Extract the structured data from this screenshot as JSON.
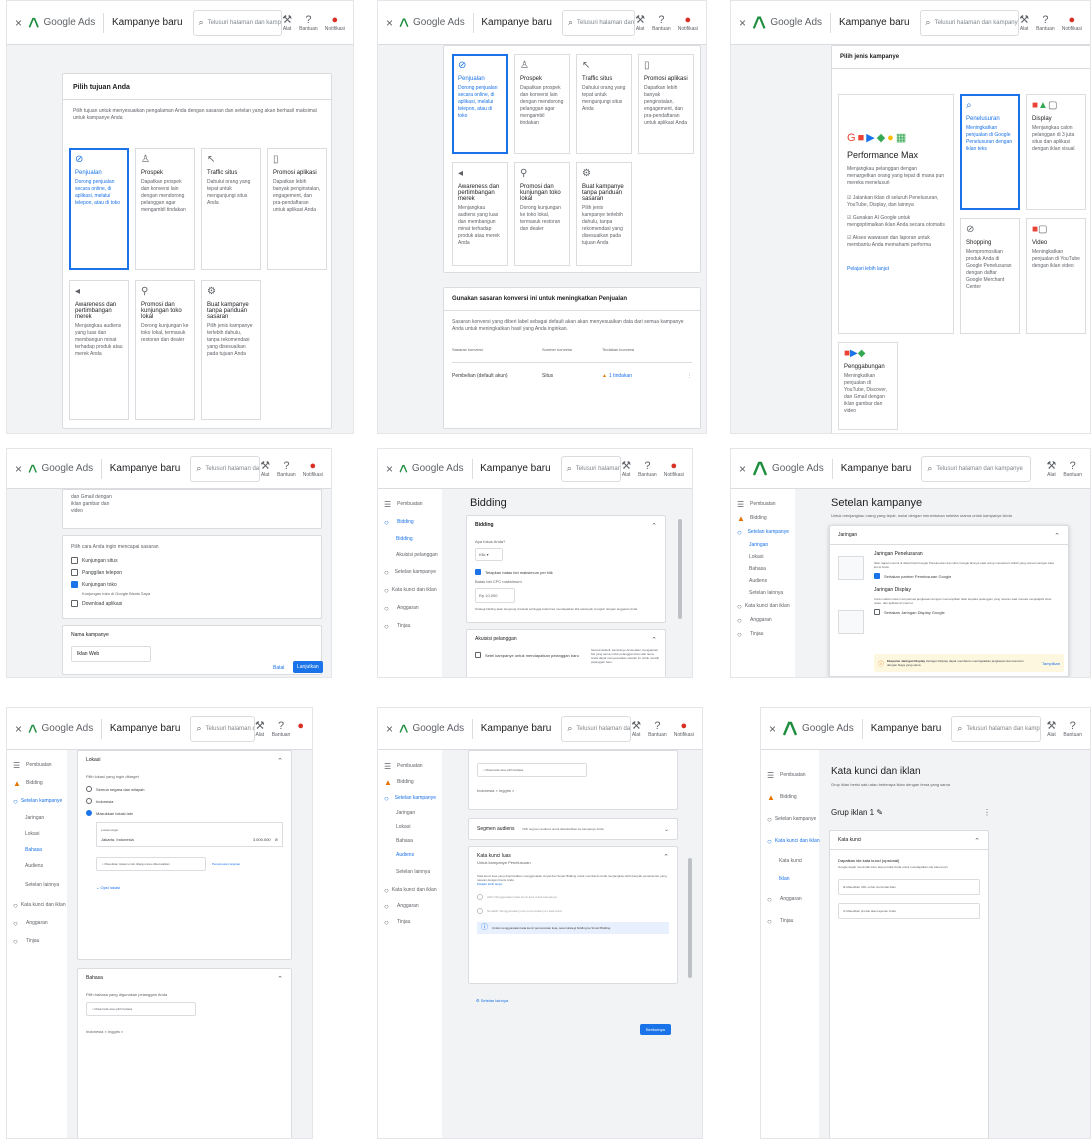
{
  "app": {
    "close_icon": "×",
    "brand": "Google Ads",
    "page_title": "Kampanye baru",
    "search_placeholder": "Telusuri halaman dan kampanye",
    "tools": [
      {
        "icon": "tools-icon",
        "label": "Alat"
      },
      {
        "icon": "help-icon",
        "label": "Bantuan"
      },
      {
        "icon": "notifications-icon",
        "label": "Notifikasi"
      }
    ],
    "accent": "#1a73e8",
    "notification_color": "#d93025"
  },
  "p1": {
    "title": "Pilih tujuan Anda",
    "subtitle": "Pilih tujuan untuk menyesuaikan pengalaman Anda dengan sasaran dan setelan yang akan berhasil maksimal untuk kampanye Anda",
    "goals": [
      {
        "icon": "tag-icon",
        "title": "Penjualan",
        "desc": "Dorong penjualan secara online, di aplikasi, melalui telepon, atau di toko",
        "selected": true
      },
      {
        "icon": "prospects-icon",
        "title": "Prospek",
        "desc": "Dapatkan prospek dan konversi lain dengan mendorong pelanggan agar mengambil tindakan",
        "selected": false
      },
      {
        "icon": "cursor-icon",
        "title": "Traffic situs",
        "desc": "Dahului orang yang tepat untuk mengunjungi situs Anda",
        "selected": false
      },
      {
        "icon": "phone-icon",
        "title": "Promosi aplikasi",
        "desc": "Dapatkan lebih banyak penginstalan, engagement, dan pra-pendaftaran untuk aplikasi Anda",
        "selected": false
      },
      {
        "icon": "megaphone-icon",
        "title": "Awareness dan pertimbangan merek",
        "desc": "Menjangkau audiens yang luas dan membangun minat terhadap produk atau merek Anda",
        "selected": false
      },
      {
        "icon": "location-icon",
        "title": "Promosi dan kunjungan toko lokal",
        "desc": "Dorong kunjungan ke toko lokal, termasuk restoran dan dealer",
        "selected": false
      },
      {
        "icon": "gear-icon",
        "title": "Buat kampanye tanpa panduan sasaran",
        "desc": "Pilih jenis kampanye terlebih dahulu, tanpa rekomendasi yang disesuaikan pada tujuan Anda",
        "selected": false
      }
    ]
  },
  "p2": {
    "conversion_title": "Gunakan sasaran konversi ini untuk meningkatkan Penjualan",
    "conversion_desc": "Sasaran konversi yang diberi label sebagai default akan akan menyesuaikan data dari semua kampanye Anda untuk meningkatkan hasil yang Anda inginkan.",
    "col_headers": [
      "Sasaran konversi",
      "Sumber konversi",
      "Tindakan konversi"
    ],
    "row": {
      "goal": "Pembelian (default akun)",
      "source": "Situs",
      "action": "1 tindakan"
    }
  },
  "p3": {
    "title": "Pilih jenis kampanye",
    "pmax_title": "Performance Max",
    "pmax_desc": "Menjangkau pelanggan dengan menargetkan orang yang tepat di mana pun mereka menelusuri",
    "pmax_bullets": [
      "Jalankan iklan di seluruh Penelusuran, YouTube, Display, dan lainnya",
      "Gunakan AI Google untuk mengoptimalkan iklan Anda secara otomatis",
      "Akses wawasan dan laporan untuk membantu Anda memahami performa"
    ],
    "pmax_link": "Pelajari lebih lanjut",
    "types": [
      {
        "title": "Penelusuran",
        "desc": "Meningkatkan penjualan di Google Penelusuran dengan iklan teks"
      },
      {
        "title": "Display",
        "desc": "Menjangkau calon pelanggan di 3 juta situs dan aplikasi dengan iklan visual"
      },
      {
        "title": "Shopping",
        "desc": "Mempromosikan produk Anda di Google Penelusuran dengan daftar Google Merchant Center"
      },
      {
        "title": "Video",
        "desc": "Meningkatkan penjualan di YouTube dengan iklan video"
      },
      {
        "title": "Penggabungan",
        "desc": "Meningkatkan penjualan di YouTube, Discover, dan Gmail dengan iklan gambar dan video"
      }
    ]
  },
  "p4": {
    "tail": "dan Gmail dengan iklan gambar dan video",
    "question": "Pilih cara Anda ingin mencapai sasaran",
    "options": [
      {
        "label": "Kunjungan situs",
        "checked": false
      },
      {
        "label": "Panggilan telepon",
        "checked": false
      },
      {
        "label": "Kunjungan toko",
        "checked": true
      },
      {
        "label": "Download aplikasi",
        "checked": false
      }
    ],
    "sub": "Kunjungan toko di Google Bisnis Saya",
    "name_title": "Nama kampanye",
    "name_value": "Iklan Web",
    "back": "Batal",
    "next": "Lanjutkan"
  },
  "p5": {
    "nav": [
      {
        "label": "Pembuatan",
        "active": false,
        "sub": false
      },
      {
        "label": "Bidding",
        "active": true,
        "sub": false
      },
      {
        "label": "Bidding",
        "active": true,
        "sub": true
      },
      {
        "label": "Akuisisi pelanggan",
        "active": false,
        "sub": true
      },
      {
        "label": "Setelan kampanye",
        "active": false,
        "sub": false
      },
      {
        "label": "Kata kunci dan iklan",
        "active": false,
        "sub": false
      },
      {
        "label": "Anggaran",
        "active": false,
        "sub": false
      },
      {
        "label": "Tinjau",
        "active": false,
        "sub": false
      }
    ],
    "heading": "Bidding",
    "section": "Bidding",
    "focus_label": "Apa fokus Anda?",
    "focus_value": "Klik",
    "cpc_check": "Tetapkan batas bid maksimum per klik",
    "cpc_label": "Batas bid CPC maksimum",
    "cpc_value": "Rp 10.000",
    "note": "Strategi bidding akan langsung di kelola sehingga Anda bisa mendapatkan klik sebanyak mungkin dengan anggaran Anda",
    "acq_title": "Akuisisi pelanggan",
    "acq_check": "Setel kampanye untuk mendapatkan pelanggan baru",
    "acq_desc": "Secara default, kampanye Anda akan mengajukan bid yang sama untuk pelanggan baru dan lama. Anda dapat menyesuaikan setelan ini untuk meraih pelanggan baru.",
    "acq_link": "Pelajari lebih lanjut"
  },
  "p6": {
    "nav": [
      {
        "label": "Pembuatan",
        "active": false,
        "sub": false
      },
      {
        "label": "Bidding",
        "active": false,
        "sub": false
      },
      {
        "label": "Setelan kampanye",
        "active": true,
        "sub": false
      },
      {
        "label": "Jaringan",
        "active": true,
        "sub": true
      },
      {
        "label": "Lokasi",
        "active": false,
        "sub": true
      },
      {
        "label": "Bahasa",
        "active": false,
        "sub": true
      },
      {
        "label": "Audiens",
        "active": false,
        "sub": true
      },
      {
        "label": "Setelan lainnya",
        "active": false,
        "sub": true
      },
      {
        "label": "Kata kunci dan iklan",
        "active": false,
        "sub": false
      },
      {
        "label": "Anggaran",
        "active": false,
        "sub": false
      },
      {
        "label": "Tinjau",
        "active": false,
        "sub": false
      }
    ],
    "heading": "Setelan kampanye",
    "sub": "Untuk menjangkau orang yang tepat, mulai dengan menentukan setelan utama untuk kampanye Anda",
    "section": "Jaringan",
    "search_net": "Jaringan Penelusuran",
    "search_desc": "Iklan dapat muncul di dekat hasil Google Penelusuran dan situs Google lainnya saat orang menelusuri istilah yang relevan dengan kata kunci Anda",
    "search_check": "Sertakan partner Penelusuran Google",
    "display_net": "Jaringan Display",
    "display_desc": "Cara mudah untuk memperluas jangkauan dengan menampilkan iklan kepada pelanggan yang relevan saat mereka menjelajahi situs, video, dan aplikasi di internet",
    "display_check": "Sertakan Jaringan Display Google",
    "note_bold": "Ekspansi Jaringan Display",
    "note_text": "Jaringan Display dapat membantu meningkatkan jangkauan dan konversi dengan biaya yang sama",
    "note_action": "Tampilkan"
  },
  "p7": {
    "loc_title": "Lokasi",
    "loc_question": "Pilih lokasi yang ingin ditarget",
    "loc_options": [
      {
        "label": "Semua negara dan wilayah",
        "checked": false
      },
      {
        "label": "Indonesia",
        "checked": false
      },
      {
        "label": "Masukkan lokasi lain",
        "checked": true
      }
    ],
    "loc_header": "Lokasi target",
    "loc_entry": "Jakarta, Indonesia",
    "loc_reach": "3.000.000",
    "loc_placeholder": "Masukkan lokasi untuk ditarget atau dikecualikan",
    "loc_link": "Penelusuran lanjutan",
    "loc_more": "Opsi lokasi",
    "lang_title": "Bahasa",
    "lang_question": "Pilih bahasa yang digunakan pelanggan Anda",
    "lang_placeholder": "Mulai ketik atau pilih bahasa",
    "lang_chips": "Indonesia ×   Inggris ×"
  },
  "p8": {
    "lang_placeholder": "Mulai ketik atau pilih bahasa",
    "lang_chips": "Indonesia ×   Inggris ×",
    "aud_title": "Segmen audiens",
    "aud_desc": "Pilih segmen audiens untuk ditambahkan ke kampanye Anda",
    "broad_title": "Kata kunci luas",
    "broad_sub": "Untuk kampanye Penelusuran",
    "broad_desc": "Kata kunci luas yang dioptimalkan menggunakan sinyal dan Smart Bidding untuk membantu Anda menjangkau lebih banyak penelusuran yang relevan dengan bisnis Anda",
    "broad_link": "Pelajari lebih lanjut",
    "radio_on": "Aktif: Menggunakan kata kunci luas untuk kampanye",
    "radio_off": "Nonaktif: Menggunakan jenis pencocokan per kata kunci",
    "info": "Untuk menggunakan kata kunci pencocokan luas, setel strategi bidding ke Smart Bidding",
    "more": "Setelan lainnya",
    "next": "Berikutnya"
  },
  "p9": {
    "nav": [
      {
        "label": "Pembuatan",
        "active": false,
        "sub": false
      },
      {
        "label": "Bidding",
        "active": false,
        "sub": false
      },
      {
        "label": "Setelan kampanye",
        "active": false,
        "sub": false
      },
      {
        "label": "Kata kunci dan iklan",
        "active": true,
        "sub": false
      },
      {
        "label": "Kata kunci",
        "active": false,
        "sub": true
      },
      {
        "label": "Iklan",
        "active": true,
        "sub": true
      },
      {
        "label": "Anggaran",
        "active": false,
        "sub": false
      },
      {
        "label": "Tinjau",
        "active": false,
        "sub": false
      }
    ],
    "heading": "Kata kunci dan iklan",
    "sub": "Grup iklan berisi satu atau beberapa iklan dengan tema yang sama",
    "group": "Grup iklan 1",
    "kw_title": "Kata kunci",
    "kw_sub": "Dapatkan ide kata kunci (opsional)",
    "kw_desc": "Google dapat memindai situs atau produk Anda untuk mendapatkan ide kata kunci",
    "kw_url": "Masukkan URL untuk memindai iklan",
    "kw_prod": "Masukkan produk atau layanan Anda"
  }
}
